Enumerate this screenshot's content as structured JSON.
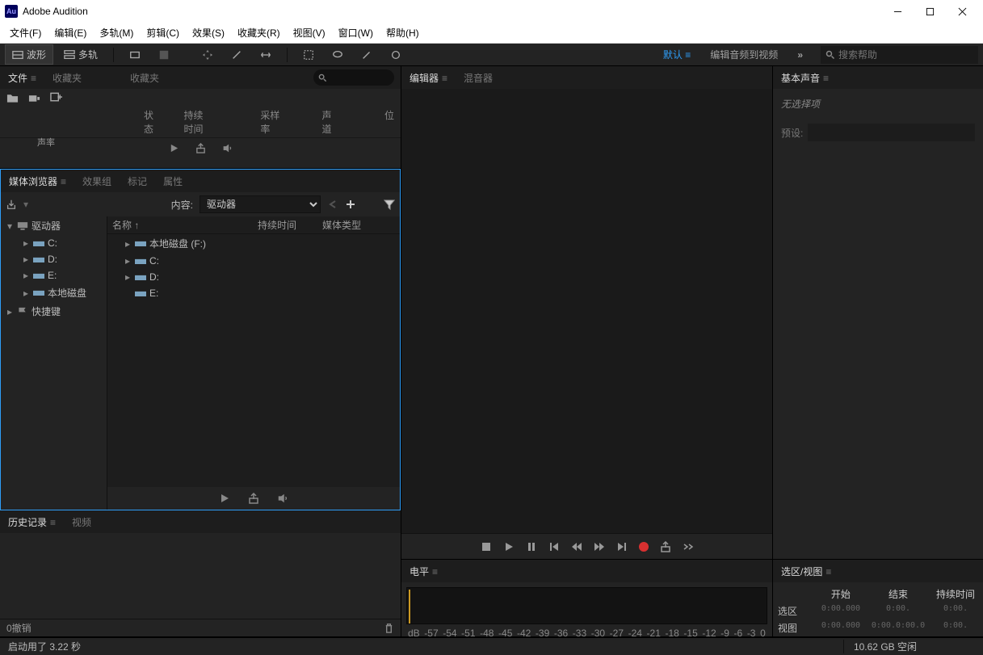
{
  "app": {
    "title": "Adobe Audition",
    "icon_text": "Au"
  },
  "menu": [
    "文件(F)",
    "编辑(E)",
    "多轨(M)",
    "剪辑(C)",
    "效果(S)",
    "收藏夹(R)",
    "视图(V)",
    "窗口(W)",
    "帮助(H)"
  ],
  "toolbar": {
    "waveform": "波形",
    "multitrack": "多轨",
    "workspace_default": "默认",
    "workspace_editvideo": "编辑音频到视频",
    "search_placeholder": "搜索帮助"
  },
  "files_panel": {
    "tabs": [
      "文件",
      "收藏夹"
    ],
    "extra_tab": "收藏夹",
    "headers": [
      "状态",
      "持续时间",
      "采样率",
      "声道",
      "位"
    ],
    "sr": "声率"
  },
  "media_panel": {
    "tabs": [
      "媒体浏览器",
      "效果组",
      "标记",
      "属性"
    ],
    "content_label": "内容:",
    "dropdown_value": "驱动器",
    "left_tree": {
      "root": "驱动器",
      "drives": [
        "C:",
        "D:",
        "E:",
        "本地磁盘"
      ],
      "shortcut": "快捷键"
    },
    "headers": {
      "name": "名称 ↑",
      "duration": "持续时间",
      "type": "媒体类型"
    },
    "right_list": [
      "本地磁盘 (F:)",
      "C:",
      "D:",
      "E:"
    ]
  },
  "history_panel": {
    "tabs": [
      "历史记录",
      "视频"
    ],
    "undo": "0撤销"
  },
  "editor_panel": {
    "tabs": [
      "编辑器",
      "混音器"
    ]
  },
  "levels_panel": {
    "title": "电平",
    "db": [
      "dB",
      "-57",
      "-54",
      "-51",
      "-48",
      "-45",
      "-42",
      "-39",
      "-36",
      "-33",
      "-30",
      "-27",
      "-24",
      "-21",
      "-18",
      "-15",
      "-12",
      "-9",
      "-6",
      "-3",
      "0"
    ]
  },
  "ess_panel": {
    "title": "基本声音",
    "noselection": "无选择项",
    "preset_label": "预设:"
  },
  "selview_panel": {
    "title": "选区/视图",
    "headers": [
      "开始",
      "结束",
      "持续时间"
    ],
    "rows": [
      "选区",
      "视图"
    ],
    "vals": {
      "sel": [
        "0:00.000",
        "0:00.",
        "0:00."
      ],
      "view": [
        "0:00.000",
        "0:00.0:00.0",
        "0:00."
      ]
    }
  },
  "status": {
    "startup": "启动用了 3.22 秒",
    "disk": "10.62 GB 空闲"
  }
}
